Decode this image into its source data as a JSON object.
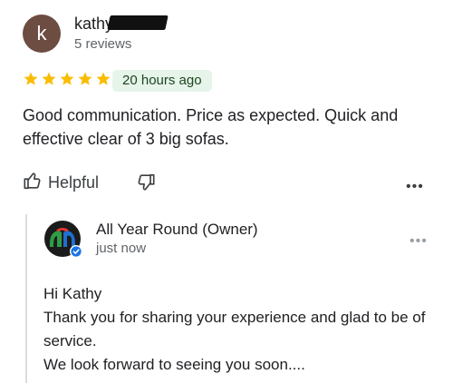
{
  "review": {
    "avatar_letter": "k",
    "reviewer_name": "kathy u",
    "reviewer_reviews": "5 reviews",
    "rating": 5,
    "rating_max": 5,
    "time": "20 hours ago",
    "text": "Good communication. Price as expected. Quick and effective clear of 3 big sofas.",
    "helpful_label": "Helpful",
    "icons": {
      "star": "star-icon",
      "helpful": "thumbs-up-icon",
      "not_helpful": "thumbs-down-icon",
      "more": "more-horizontal-icon"
    }
  },
  "owner_reply": {
    "name": "All Year Round (Owner)",
    "time": "just now",
    "greeting": "Hi Kathy",
    "line1": "Thank you for sharing your experience and glad to be of service.",
    "line2": "We look forward to seeing you soon...."
  },
  "colors": {
    "avatar_bg": "#6d4c41",
    "star": "#fbbc04",
    "badge_bg": "#e6f4ea",
    "badge_text": "#1e4620",
    "verified": "#1a73e8"
  }
}
